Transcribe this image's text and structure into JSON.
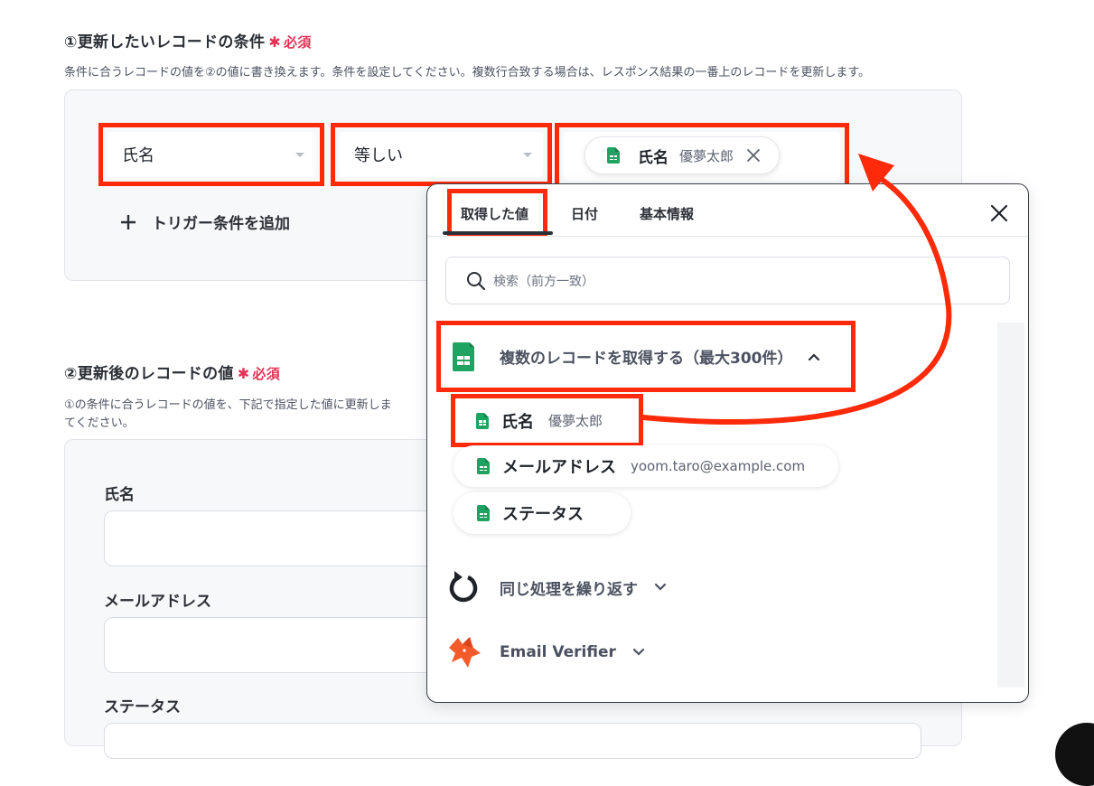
{
  "section1": {
    "title": "①更新したいレコードの条件",
    "required": "必須",
    "description": "条件に合うレコードの値を②の値に書き換えます。条件を設定してください。複数行合致する場合は、レスポンス結果の一番上のレコードを更新します。",
    "field_select": "氏名",
    "operator_select": "等しい",
    "value_chip": {
      "name": "氏名",
      "value": "優夢太郎"
    },
    "add_condition": "トリガー条件を追加"
  },
  "section2": {
    "title": "②更新後のレコードの値",
    "required": "必須",
    "description_line1": "①の条件に合うレコードの値を、下記で指定した値に更新しま",
    "description_line2": "てください。",
    "fields": [
      "氏名",
      "メールアドレス",
      "ステータス"
    ]
  },
  "popup": {
    "tabs": [
      "取得した値",
      "日付",
      "基本情報"
    ],
    "search_placeholder": "検索（前方一致）",
    "group1": {
      "title": "複数のレコードを取得する（最大300件）",
      "items": [
        {
          "name": "氏名",
          "value": "優夢太郎"
        },
        {
          "name": "メールアドレス",
          "value": "yoom.taro@example.com"
        },
        {
          "name": "ステータス",
          "value": ""
        }
      ]
    },
    "group2": {
      "title": "同じ処理を繰り返す"
    },
    "group3": {
      "title": "Email Verifier"
    }
  },
  "colors": {
    "highlight_red": "#ff2a0a",
    "required_pink": "#e53155",
    "sheets_green": "#1ea362",
    "fox_orange": "#f45a2a"
  }
}
